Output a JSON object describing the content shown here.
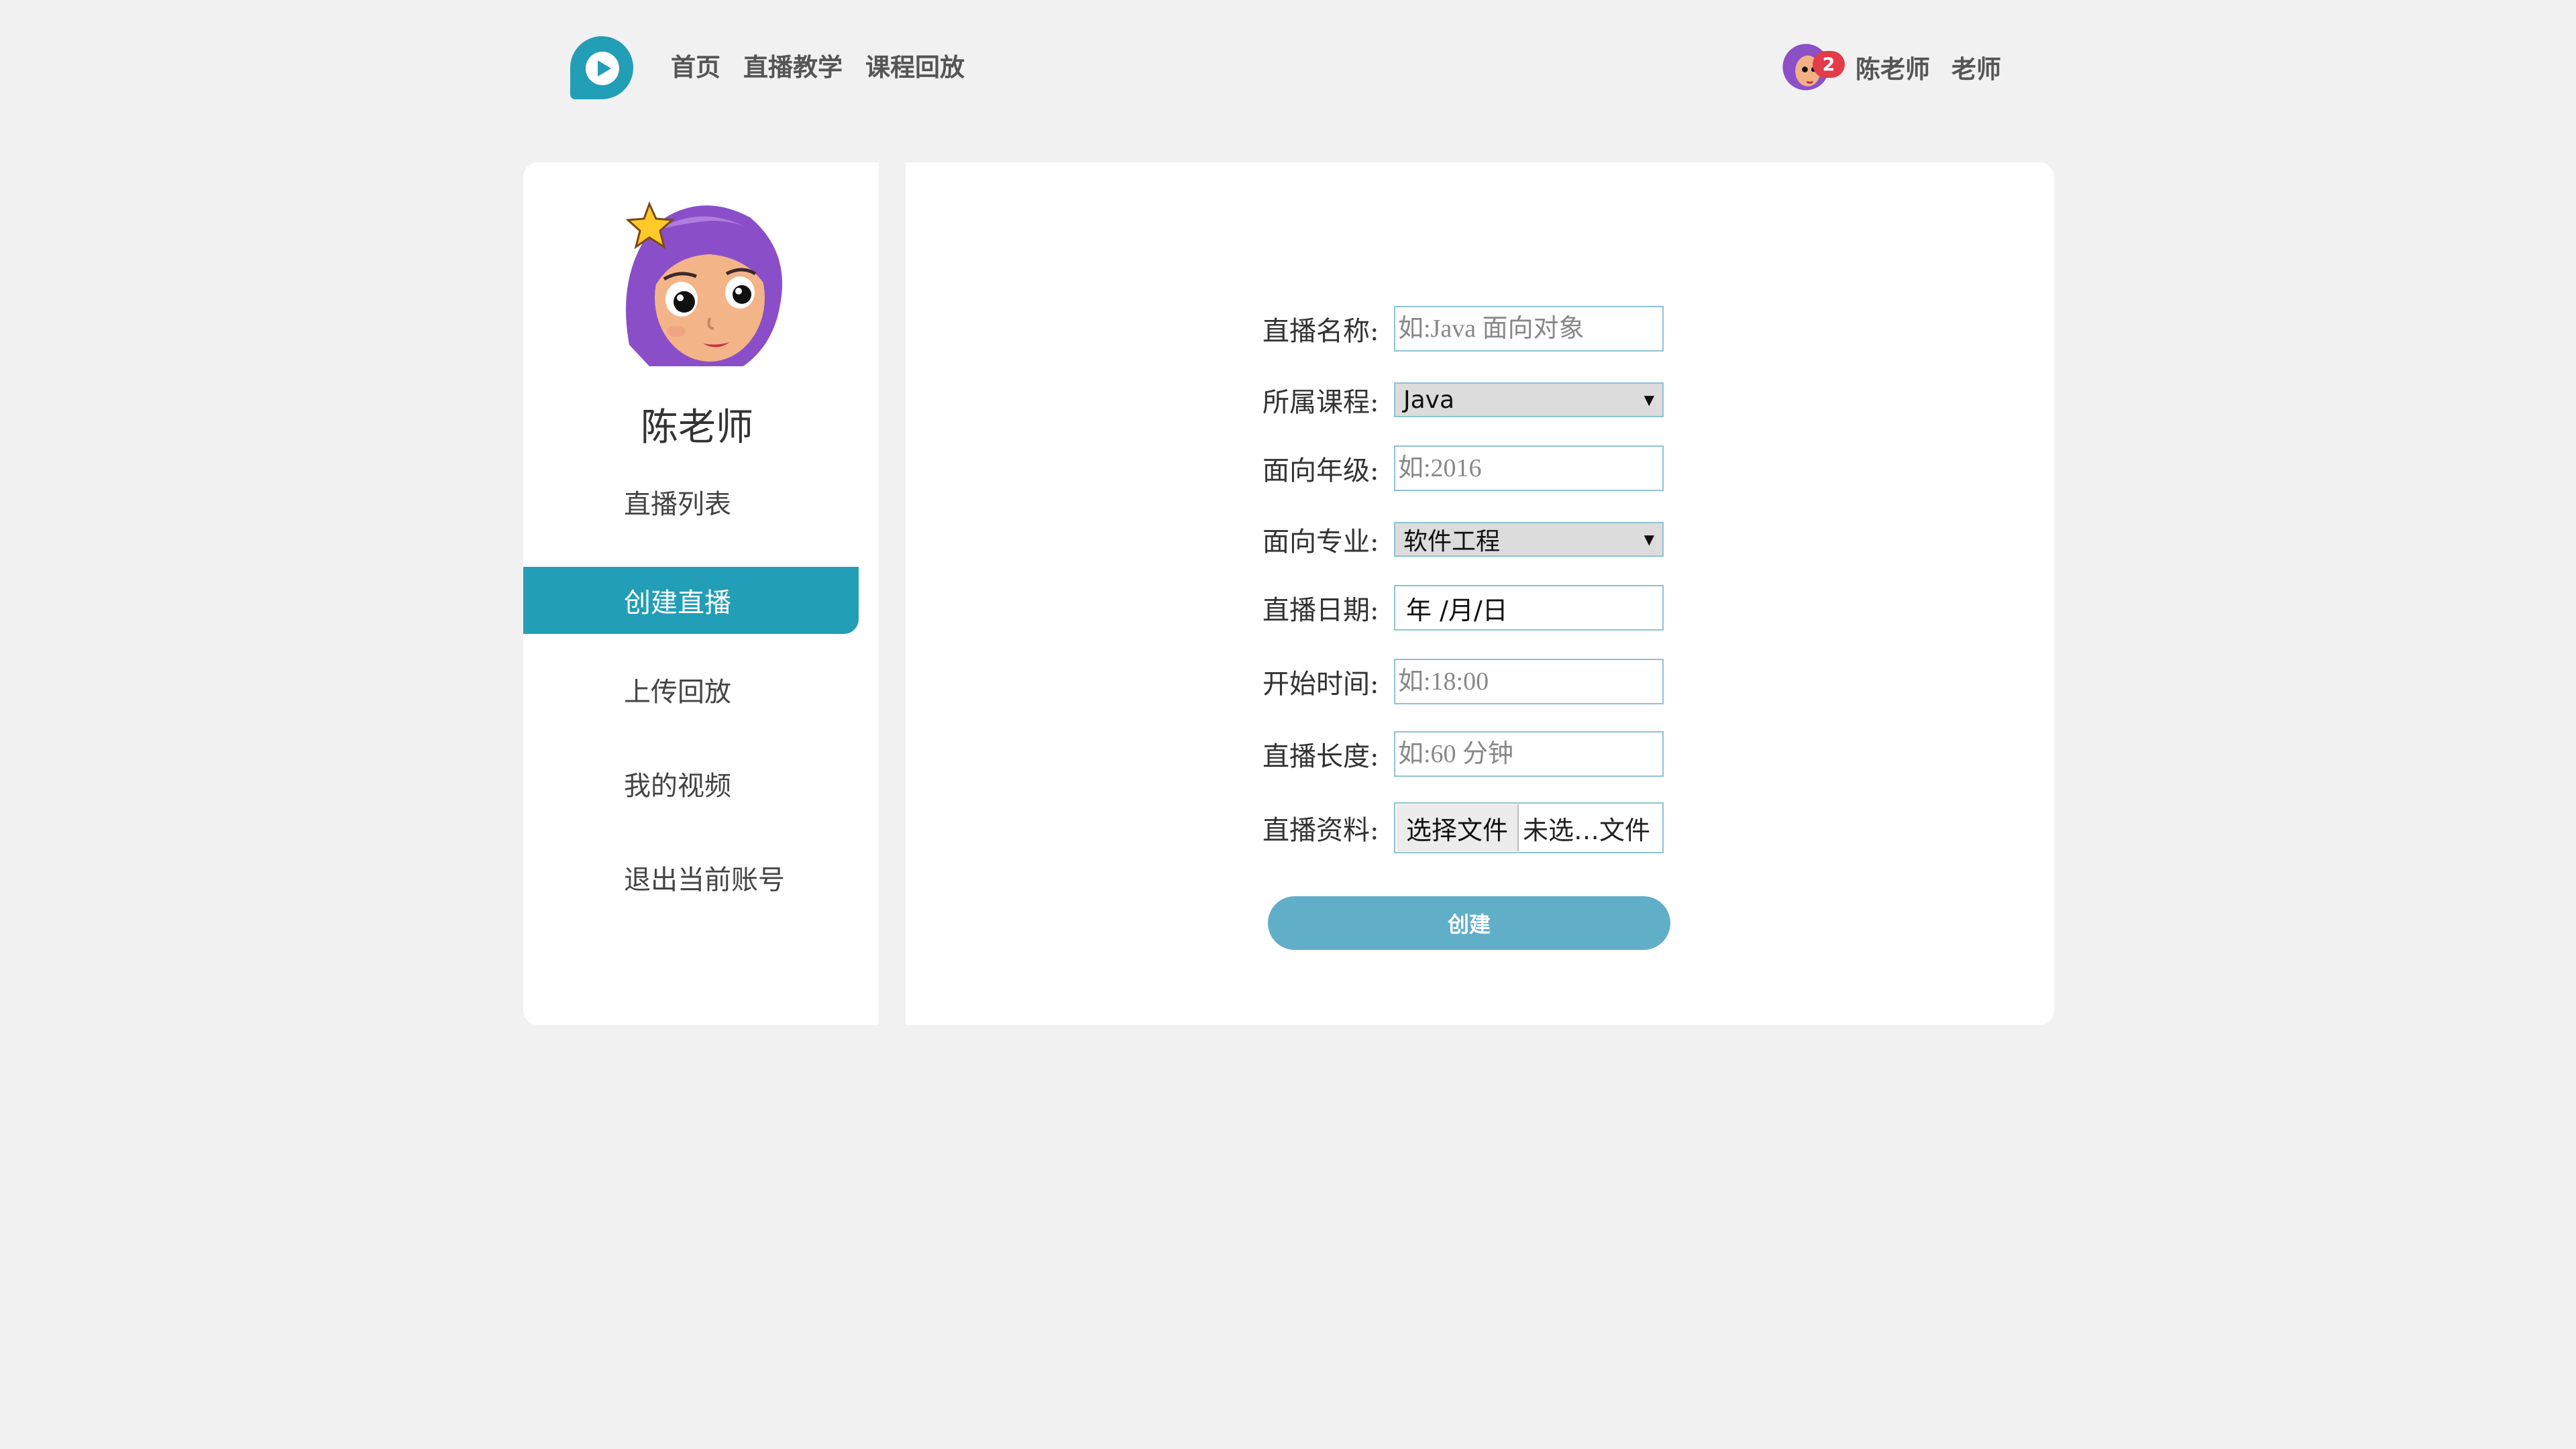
{
  "header": {
    "nav": [
      "首页",
      "直播教学",
      "课程回放"
    ],
    "badge_count": "2",
    "user_name": "陈老师",
    "user_role": "老师"
  },
  "sidebar": {
    "teacher_name": "陈老师",
    "items": [
      {
        "label": "直播列表",
        "active": false
      },
      {
        "label": "创建直播",
        "active": true
      },
      {
        "label": "上传回放",
        "active": false
      },
      {
        "label": "我的视频",
        "active": false
      },
      {
        "label": "退出当前账号",
        "active": false
      }
    ]
  },
  "form": {
    "name": {
      "label": "直播名称:",
      "placeholder": "如:Java 面向对象"
    },
    "course": {
      "label": "所属课程:",
      "value": "Java"
    },
    "grade": {
      "label": "面向年级:",
      "placeholder": "如:2016"
    },
    "major": {
      "label": "面向专业:",
      "value": "软件工程"
    },
    "date": {
      "label": "直播日期:",
      "value": "年 /月/日"
    },
    "start": {
      "label": "开始时间:",
      "placeholder": "如:18:00"
    },
    "length": {
      "label": "直播长度:",
      "placeholder": "如:60 分钟"
    },
    "file": {
      "label": "直播资料:",
      "button": "选择文件",
      "status": "未选…文件"
    },
    "submit": "创建"
  },
  "colors": {
    "accent": "#229eb6",
    "submit": "#61aec9",
    "badge": "#e23b4a"
  }
}
